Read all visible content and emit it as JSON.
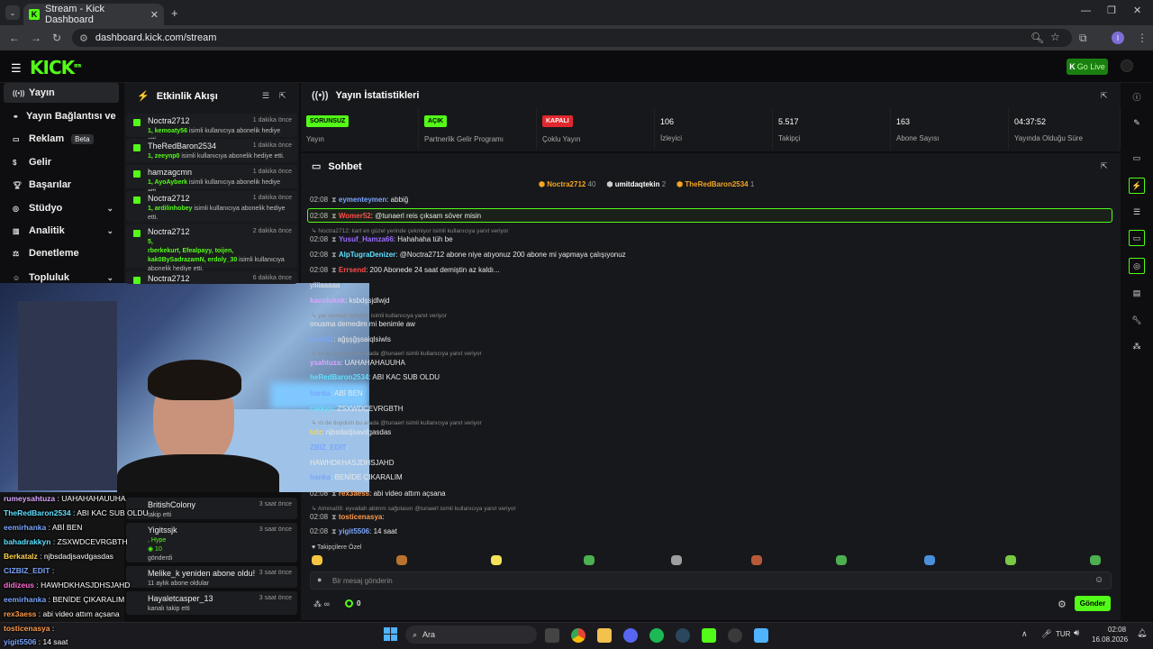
{
  "browser": {
    "tab_title": "Stream - Kick Dashboard",
    "url": "dashboard.kick.com/stream",
    "profile_initial": "I"
  },
  "header": {
    "logo": "KICK",
    "logo_sup": "BETA",
    "go_live": "Go Live"
  },
  "sidebar": {
    "items": [
      {
        "label": "Yayın",
        "icon": "stream-icon"
      },
      {
        "label": "Yayın Bağlantısı ve Anahtarı",
        "icon": "link-icon"
      },
      {
        "label": "Reklam",
        "icon": "ad-icon",
        "badge": "Beta"
      },
      {
        "label": "Gelir",
        "icon": "money-icon"
      },
      {
        "label": "Başarılar",
        "icon": "trophy-icon"
      },
      {
        "label": "Stüdyo",
        "icon": "studio-icon"
      },
      {
        "label": "Analitik",
        "icon": "analytics-icon"
      },
      {
        "label": "Denetleme",
        "icon": "gavel-icon"
      },
      {
        "label": "Topluluk",
        "icon": "community-icon"
      }
    ]
  },
  "activity": {
    "title": "Etkinlik Akışı",
    "items": [
      {
        "name": "Noctra2712",
        "time": "1 dakika önce",
        "gifted": "1, kemoaty56",
        "text": "isimli kullanıcıya abonelik hediye etti."
      },
      {
        "name": "TheRedBaron2534",
        "time": "1 dakika önce",
        "gifted": "1, zeeynp0",
        "text": "isimli kullanıcıya abonelik hediye etti."
      },
      {
        "name": "hamzagcmn",
        "time": "1 dakika önce",
        "gifted": "1, AyoAyberk",
        "text": "isimli kullanıcıya abonelik hediye etti."
      },
      {
        "name": "Noctra2712",
        "time": "1 dakika önce",
        "gifted": "1, ardilinhobey",
        "text": "isimli kullanıcıya abonelik hediye etti."
      },
      {
        "name": "Noctra2712",
        "time": "2 dakika önce",
        "gifted": "5,",
        "gifted2": "rberkekurt, Efealpayy, toijen, kak0BySadrazamN, erdoly_30",
        "text": "isimli kullanıcıya abonelik hediye etti."
      },
      {
        "name": "Noctra2712",
        "time": "6 dakika önce"
      }
    ],
    "lower": [
      {
        "name": "BritishColony",
        "time": "3 saat önce",
        "text": "takip etti"
      },
      {
        "name": "Yigitssjk",
        "time": "3 saat önce",
        "text": ", Hype",
        "amount": "10",
        "text2": "gönderdi"
      },
      {
        "name": "Melike_k yeniden abone oldu!",
        "time": "3 saat önce",
        "text": "11 aylık abone oldular"
      },
      {
        "name": "Hayaletcasper_13",
        "time": "3 saat önce",
        "text": "kanalı takip etti"
      }
    ]
  },
  "stats": {
    "title": "Yayın İstatistikleri",
    "items": [
      {
        "value": "SORUNSUZ",
        "label": "Yayın",
        "badge_color": "#53fc18"
      },
      {
        "value": "AÇIK",
        "label": "Partnerlik Gelir Programı",
        "badge_color": "#53fc18"
      },
      {
        "value": "KAPALI",
        "label": "Çoklu Yayın",
        "badge_color": "#e0282e"
      },
      {
        "value": "106",
        "label": "İzleyici"
      },
      {
        "value": "5.517",
        "label": "Takipçi"
      },
      {
        "value": "163",
        "label": "Abone Sayısı"
      },
      {
        "value": "04:37:52",
        "label": "Yayında Olduğu Süre"
      }
    ]
  },
  "chat": {
    "title": "Sohbet",
    "top_gifters": [
      {
        "name": "Noctra2712",
        "count": "40"
      },
      {
        "name": "umitdaqtekin",
        "count": "2"
      },
      {
        "name": "TheRedBaron2534",
        "count": "1"
      }
    ],
    "messages": [
      {
        "time": "02:08",
        "user": "eymenteymen",
        "color": "#7aa5ff",
        "text": ": abbiğ"
      },
      {
        "time": "02:08",
        "user": "Womer52",
        "color": "#ff4d4d",
        "text": ": @tunaerl reis çıksam söver misin"
      },
      {
        "reply": "Noctra2712: kart en güzel yerinde çekmiyor isimli kullanıcıya yanıt veriyor"
      },
      {
        "time": "02:08",
        "user": "Yusuf_Hamza66",
        "color": "#9b6bff",
        "text": ": Hahahaha tüh be"
      },
      {
        "time": "02:08",
        "user": "AlpTugraDenizer",
        "color": "#5fe0ff",
        "text": ": @Noctra2712 abone niye atıyonuz 200 abone mi yapmaya çalışıyonuz"
      },
      {
        "time": "02:08",
        "user": "Errsend",
        "color": "#ff4d4d",
        "text": ": 200 Abonede 24 saat demiştin az kaldı..."
      },
      {
        "text": "yiiiiaaaaa"
      },
      {
        "user": "kaoolukek",
        "color": "#d9a6ff",
        "text": ": ksbdşsjdlwjd"
      },
      {
        "reply": "yar olursun öyleeee isimli kullanıcıya yanıt veriyor"
      },
      {
        "text": "onusma demedim mi benimle aw"
      },
      {
        "user": "nuro11",
        "color": "#7aa5ff",
        "text": ": ağşşğşsaiqlsiwls"
      },
      {
        "reply": "rü de duydum bu arada @tunaerl isimli kullanıcıya yanıt veriyor"
      },
      {
        "user": "ysahtuza",
        "color": "#d9a6ff",
        "text": ": UAHAHAHAUUHA"
      },
      {
        "user": "heRedBaron2534",
        "color": "#5fe0ff",
        "text": ": ABI KAC SUB OLDU"
      },
      {
        "user": "hanka",
        "color": "#7aa5ff",
        "text": ": ABİ BEN"
      },
      {
        "user": "rakkyn",
        "color": "#5fe0ff",
        "text": ": ZSXWDCEVRGBTH"
      },
      {
        "reply": "rü de duydum bu arada @tunaerl isimli kullanıcıya yanıt veriyor"
      },
      {
        "user": "talz",
        "color": "#ffd24d",
        "text": ": njbsdadjsavdgasdas"
      },
      {
        "user": "ZBIZ_EDIT",
        "color": "#7aa5ff",
        "text": ":"
      },
      {
        "text": "HAWHDKHASJDHSJAHD"
      },
      {
        "user": "hanka",
        "color": "#7aa5ff",
        "text": ": BENİDE ÇIKARALIM"
      },
      {
        "time": "02:08",
        "user": "rex3aess",
        "color": "#ff9b4d",
        "text": ": abi video attım açsana"
      },
      {
        "reply": "Almina08: eyvallah abimm sağolasın @tunaerl isimli kullanıcıya yanıt veriyor"
      },
      {
        "time": "02:08",
        "user": "tosticenasya",
        "color": "#ff9b4d",
        "text": ":"
      },
      {
        "time": "02:08",
        "user": "yigit5506",
        "color": "#7aa5ff",
        "text": ": 14 saat"
      }
    ],
    "emote_section": "Takipçilere Özel",
    "input_placeholder": "Bir mesaj gönderin",
    "send_button": "Gönder",
    "points": "0"
  },
  "overlay_chat": [
    {
      "user": "rumeysahtuza",
      "color": "#d9a6ff",
      "text": " : UAHAHAHAUUHA"
    },
    {
      "user": "TheRedBaron2534",
      "color": "#5fe0ff",
      "text": " : ABI KAC SUB OLDU"
    },
    {
      "user": "eemirhanka",
      "color": "#7aa5ff",
      "text": " : ABİ BEN"
    },
    {
      "user": "bahadrakkyn",
      "color": "#5fe0ff",
      "text": " : ZSXWDCEVRGBTH"
    },
    {
      "user": "Berkatalz",
      "color": "#ffd24d",
      "text": " : njbsdadjsavdgasdas"
    },
    {
      "user": "CIZBIZ_EDIT",
      "color": "#7aa5ff",
      "text": " :"
    },
    {
      "user": "didizeus",
      "color": "#ff6bd6",
      "text": " : HAWHDKHASJDHSJAHD"
    },
    {
      "user": "eemirhanka",
      "color": "#7aa5ff",
      "text": " : BENİDE ÇIKARALIM"
    },
    {
      "user": "rex3aess",
      "color": "#ff9b4d",
      "text": " : abi video attım açsana"
    },
    {
      "user": "tosticenasya",
      "color": "#ff9b4d",
      "text": " :"
    },
    {
      "user": "yigit5506",
      "color": "#7aa5ff",
      "text": " : 14 saat"
    }
  ],
  "taskbar": {
    "search": "Ara",
    "time": "02:08",
    "date": "16.08.2026",
    "lang": "TUR"
  }
}
